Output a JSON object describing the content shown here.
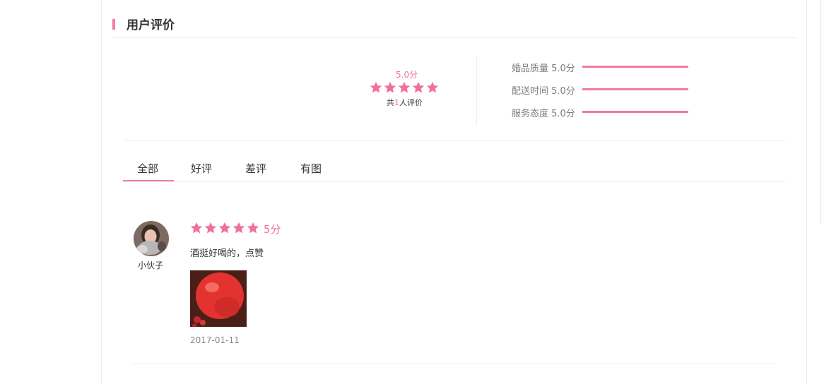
{
  "section": {
    "title": "用户评价"
  },
  "summary": {
    "overall_score": "5.0分",
    "overall_rating": 5,
    "total_prefix": "共",
    "total_count": "1",
    "total_suffix": "人评价",
    "metrics": [
      {
        "label": "婚品质量 5.0分",
        "level": 1.0
      },
      {
        "label": "配送时间 5.0分",
        "level": 1.0
      },
      {
        "label": "服务态度 5.0分",
        "level": 1.0
      }
    ]
  },
  "tabs": [
    {
      "label": "全部",
      "active": true
    },
    {
      "label": "好评",
      "active": false
    },
    {
      "label": "差评",
      "active": false
    },
    {
      "label": "有图",
      "active": false
    }
  ],
  "review": {
    "username": "小伙子",
    "rating": 5,
    "score": "5分",
    "text": "酒挺好喝的，点赞",
    "date": "2017-01-11"
  },
  "colors": {
    "accent": "#f27ea6",
    "star": "#f0709c"
  }
}
